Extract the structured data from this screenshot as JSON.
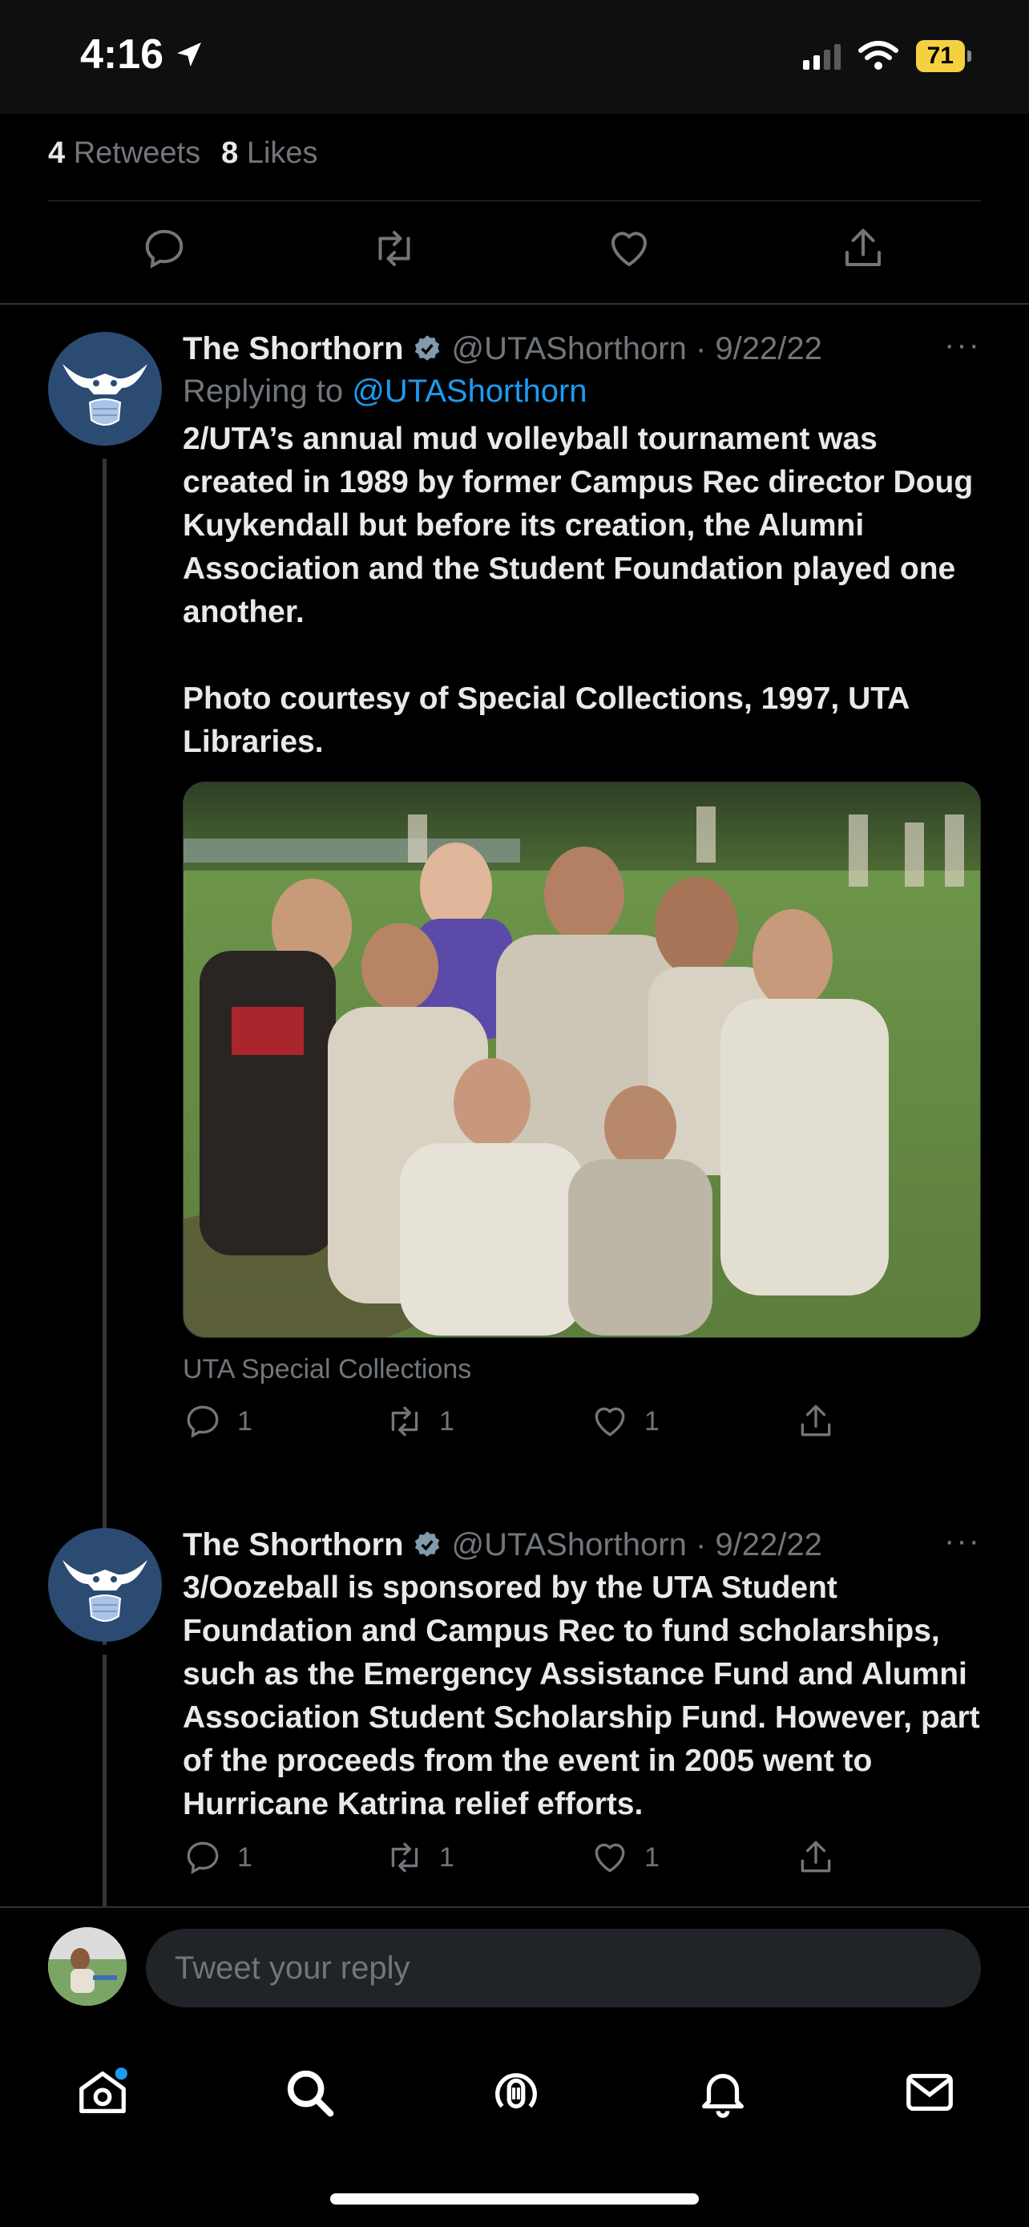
{
  "status_bar": {
    "time": "4:16",
    "battery": "71",
    "battery_color": "#f5d142"
  },
  "main_tweet_stats": {
    "retweets_count": "4",
    "retweets_label": "Retweets",
    "likes_count": "8",
    "likes_label": "Likes"
  },
  "colors": {
    "background": "#000000",
    "accent": "#1d9bf0",
    "muted": "#71767b",
    "text": "#e7e9ea"
  },
  "tweets": [
    {
      "name": "The Shorthorn",
      "handle": "@UTAShorthorn",
      "date": "· 9/22/22",
      "more": "···",
      "replying_prefix": "Replying to",
      "replying_to": "@UTAShorthorn",
      "text": "2/UTA’s annual mud volleyball tournament was created in 1989 by former Campus Rec director Doug Kuykendall but before its creation, the Alumni Association and the Student Foundation played one another.\n\nPhoto courtesy of Special Collections, 1997, UTA Libraries.",
      "media_caption": "UTA Special Collections",
      "replies": "1",
      "retweets": "1",
      "likes": "1"
    },
    {
      "name": "The Shorthorn",
      "handle": "@UTAShorthorn",
      "date": "· 9/22/22",
      "more": "···",
      "text": "3/Oozeball is sponsored by the UTA Student Foundation and Campus Rec to fund scholarships, such as the Emergency Assistance Fund and Alumni Association Student Scholarship Fund. However, part of the proceeds from the event in 2005 went to Hurricane Katrina relief efforts.",
      "replies": "1",
      "retweets": "1",
      "likes": "1"
    }
  ],
  "reply": {
    "placeholder": "Tweet your reply"
  },
  "tab_bar": {
    "items": [
      "home-icon",
      "search-icon",
      "spaces-icon",
      "notifications-icon",
      "messages-icon"
    ]
  }
}
